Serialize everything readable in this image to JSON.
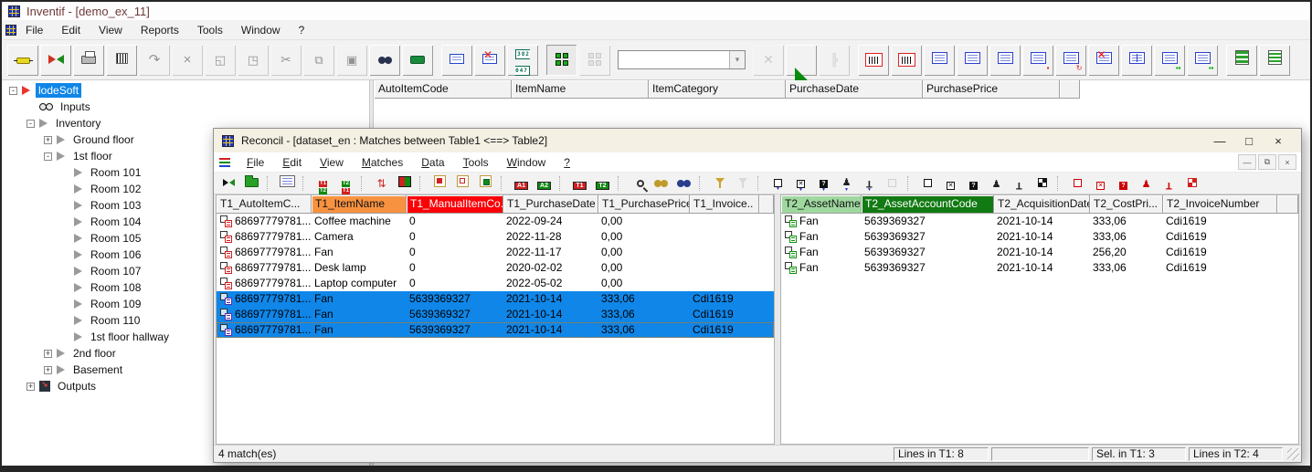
{
  "colors": {
    "selection_blue": "#0f86e8",
    "header_orange": "#f79240",
    "header_red": "#fb0107",
    "header_light_green": "#9fd89f",
    "header_dark_green": "#127a12",
    "title_text": "#6e3a38"
  },
  "main_window": {
    "title": "Inventif - [demo_ex_11]",
    "menu": [
      "File",
      "Edit",
      "View",
      "Reports",
      "Tools",
      "Window",
      "?"
    ],
    "toolbar_combo_value": "",
    "toolbar": [
      {
        "icon": "connector",
        "enabled": true
      },
      {
        "icon": "swap-arrows",
        "enabled": true
      },
      {
        "icon": "printer",
        "enabled": true
      },
      {
        "icon": "barcode-printer",
        "enabled": true
      },
      {
        "icon": "redo",
        "enabled": false
      },
      {
        "icon": "delete-line",
        "enabled": false
      },
      {
        "icon": "copy-item",
        "enabled": false
      },
      {
        "icon": "cut-item",
        "enabled": false
      },
      {
        "icon": "cut",
        "enabled": false
      },
      {
        "icon": "copy",
        "enabled": false
      },
      {
        "icon": "paste",
        "enabled": false
      },
      {
        "icon": "find-binoculars",
        "enabled": true
      },
      {
        "icon": "scanner",
        "enabled": true
      },
      {
        "type": "sep"
      },
      {
        "icon": "memo-card",
        "enabled": true
      },
      {
        "icon": "mail-delete",
        "enabled": true
      },
      {
        "icon": "counter-digits",
        "enabled": true
      },
      {
        "type": "sep"
      },
      {
        "icon": "group-objects",
        "enabled": true,
        "pressed": true
      },
      {
        "icon": "group-objects-alt",
        "enabled": false
      },
      {
        "type": "combo"
      },
      {
        "icon": "delete-cross",
        "enabled": false
      },
      {
        "icon": "set-square",
        "enabled": true
      },
      {
        "icon": "hierarchy",
        "enabled": false
      },
      {
        "type": "sep"
      },
      {
        "icon": "barcode-labels",
        "enabled": true
      },
      {
        "icon": "barcode-labels-alt",
        "enabled": true
      },
      {
        "icon": "doc-lines",
        "enabled": true
      },
      {
        "icon": "doc-list",
        "enabled": true
      },
      {
        "icon": "doc-list-detail",
        "enabled": true
      },
      {
        "icon": "doc-cube",
        "enabled": true
      },
      {
        "icon": "doc-refresh",
        "enabled": true
      },
      {
        "icon": "doc-delete",
        "enabled": true
      },
      {
        "icon": "doc-columns",
        "enabled": true
      },
      {
        "icon": "doc-cubes",
        "enabled": true
      },
      {
        "icon": "doc-cubes-alt",
        "enabled": true
      },
      {
        "type": "sep"
      },
      {
        "icon": "green-rows",
        "enabled": true
      },
      {
        "icon": "green-rows-alt",
        "enabled": true
      }
    ],
    "background_table": {
      "columns": [
        "AutoItemCode",
        "ItemName",
        "ItemCategory",
        "PurchaseDate",
        "PurchasePrice"
      ]
    },
    "tree": {
      "items": [
        {
          "label": "lodeSoft",
          "level": 0,
          "expander": "-",
          "icon": "red-arrow",
          "selected": true
        },
        {
          "label": "Inputs",
          "level": 1,
          "icon": "binoculars"
        },
        {
          "label": "Inventory",
          "level": 1,
          "expander": "-",
          "icon": "arrow"
        },
        {
          "label": "Ground floor",
          "level": 2,
          "expander": "+",
          "icon": "arrow"
        },
        {
          "label": "1st floor",
          "level": 2,
          "expander": "-",
          "icon": "arrow"
        },
        {
          "label": "Room 101",
          "level": 3,
          "icon": "arrow"
        },
        {
          "label": "Room 102",
          "level": 3,
          "icon": "arrow"
        },
        {
          "label": "Room 103",
          "level": 3,
          "icon": "arrow"
        },
        {
          "label": "Room 104",
          "level": 3,
          "icon": "arrow"
        },
        {
          "label": "Room 105",
          "level": 3,
          "icon": "arrow"
        },
        {
          "label": "Room 106",
          "level": 3,
          "icon": "arrow"
        },
        {
          "label": "Room 107",
          "level": 3,
          "icon": "arrow"
        },
        {
          "label": "Room 108",
          "level": 3,
          "icon": "arrow"
        },
        {
          "label": "Room 109",
          "level": 3,
          "icon": "arrow"
        },
        {
          "label": "Room 110",
          "level": 3,
          "icon": "arrow"
        },
        {
          "label": "1st floor hallway",
          "level": 3,
          "icon": "arrow"
        },
        {
          "label": "2nd floor",
          "level": 2,
          "expander": "+",
          "icon": "arrow"
        },
        {
          "label": "Basement",
          "level": 2,
          "expander": "+",
          "icon": "arrow"
        },
        {
          "label": "Outputs",
          "level": 1,
          "expander": "+",
          "icon": "outputs"
        }
      ]
    }
  },
  "reconcil_window": {
    "title": "Reconcil - [dataset_en : Matches between Table1 <==> Table2]",
    "window_buttons": [
      "minimize",
      "maximize",
      "close"
    ],
    "menu": [
      "File",
      "Edit",
      "View",
      "Matches",
      "Data",
      "Tools",
      "Window",
      "?"
    ],
    "mdi_buttons": [
      "minimize",
      "restore",
      "close"
    ],
    "toolbar": [
      {
        "icon": "match-arrows",
        "enabled": true
      },
      {
        "icon": "open-folder",
        "enabled": true
      },
      {
        "type": "sep"
      },
      {
        "icon": "properties-form",
        "enabled": true
      },
      {
        "type": "sep"
      },
      {
        "icon": "transfer-t1-t2",
        "enabled": true
      },
      {
        "icon": "transfer-t2-t1",
        "enabled": true
      },
      {
        "type": "sep"
      },
      {
        "icon": "sort-matches",
        "enabled": true
      },
      {
        "icon": "split-red-green",
        "enabled": true
      },
      {
        "type": "sep"
      },
      {
        "icon": "frame-filled",
        "enabled": true
      },
      {
        "icon": "frame-outline",
        "enabled": true
      },
      {
        "icon": "frame-green",
        "enabled": true
      },
      {
        "type": "sep"
      },
      {
        "icon": "badge-a1",
        "enabled": true
      },
      {
        "icon": "badge-a2",
        "enabled": true
      },
      {
        "type": "sep"
      },
      {
        "icon": "badge-t1",
        "enabled": true
      },
      {
        "icon": "badge-t2",
        "enabled": true
      },
      {
        "type": "sep"
      },
      {
        "icon": "zoom-search",
        "enabled": true
      },
      {
        "icon": "find-gold",
        "enabled": true
      },
      {
        "icon": "find-blue",
        "enabled": true
      },
      {
        "type": "sep"
      },
      {
        "icon": "filter",
        "enabled": true
      },
      {
        "icon": "filter-off",
        "enabled": false
      },
      {
        "type": "sep"
      },
      {
        "icon": "show-marked-box",
        "enabled": true
      },
      {
        "icon": "show-marked-cross",
        "enabled": true
      },
      {
        "icon": "show-marked-question",
        "enabled": true
      },
      {
        "icon": "show-marked-stamp-user",
        "enabled": true
      },
      {
        "icon": "show-marked-stamp",
        "enabled": true
      },
      {
        "icon": "show-marked-off",
        "enabled": false
      },
      {
        "type": "sep"
      },
      {
        "icon": "mark-box",
        "enabled": true
      },
      {
        "icon": "mark-cross",
        "enabled": true
      },
      {
        "icon": "mark-question",
        "enabled": true
      },
      {
        "icon": "mark-stamp-user",
        "enabled": true
      },
      {
        "icon": "mark-stamp",
        "enabled": true
      },
      {
        "icon": "mark-auto",
        "enabled": true
      },
      {
        "type": "sep"
      },
      {
        "icon": "unmark-box",
        "enabled": true
      },
      {
        "icon": "unmark-cross",
        "enabled": true
      },
      {
        "icon": "unmark-question",
        "enabled": true
      },
      {
        "icon": "unmark-stamp-user",
        "enabled": true
      },
      {
        "icon": "unmark-stamp",
        "enabled": true
      },
      {
        "icon": "unmark-auto",
        "enabled": true
      }
    ],
    "table1": {
      "columns": [
        {
          "label": "T1_AutoItemC...",
          "highlight": ""
        },
        {
          "label": "T1_ItemName",
          "highlight": "orange"
        },
        {
          "label": "T1_ManualItemCo...",
          "highlight": "red"
        },
        {
          "label": "T1_PurchaseDate",
          "highlight": ""
        },
        {
          "label": "T1_PurchasePrice",
          "highlight": ""
        },
        {
          "label": "T1_Invoice..",
          "highlight": ""
        }
      ],
      "rows": [
        {
          "icon": "unmatched",
          "cells": [
            "68697779781...",
            "Coffee machine",
            "0",
            "2022-09-24",
            "0,00",
            ""
          ]
        },
        {
          "icon": "unmatched",
          "cells": [
            "68697779781...",
            "Camera",
            "0",
            "2022-11-28",
            "0,00",
            ""
          ]
        },
        {
          "icon": "unmatched",
          "cells": [
            "68697779781...",
            "Fan",
            "0",
            "2022-11-17",
            "0,00",
            ""
          ]
        },
        {
          "icon": "unmatched",
          "cells": [
            "68697779781...",
            "Desk lamp",
            "0",
            "2020-02-02",
            "0,00",
            ""
          ]
        },
        {
          "icon": "unmatched",
          "cells": [
            "68697779781...",
            "Laptop computer",
            "0",
            "2022-05-02",
            "0,00",
            ""
          ]
        },
        {
          "icon": "matched",
          "selected": true,
          "cells": [
            "68697779781...",
            "Fan",
            "5639369327",
            "2021-10-14",
            "333,06",
            "Cdi1619"
          ]
        },
        {
          "icon": "matched",
          "selected": true,
          "cells": [
            "68697779781...",
            "Fan",
            "5639369327",
            "2021-10-14",
            "333,06",
            "Cdi1619"
          ]
        },
        {
          "icon": "matched",
          "selected": true,
          "focused": true,
          "cells": [
            "68697779781...",
            "Fan",
            "5639369327",
            "2021-10-14",
            "333,06",
            "Cdi1619"
          ]
        }
      ]
    },
    "table2": {
      "columns": [
        {
          "label": "T2_AssetName",
          "highlight": "lgreen"
        },
        {
          "label": "T2_AssetAccountCode",
          "highlight": "dgreen"
        },
        {
          "label": "T2_AcquisitionDate",
          "highlight": ""
        },
        {
          "label": "T2_CostPri...",
          "highlight": ""
        },
        {
          "label": "T2_InvoiceNumber",
          "highlight": ""
        }
      ],
      "rows": [
        {
          "icon": "matched",
          "cells": [
            "Fan",
            "5639369327",
            "2021-10-14",
            "333,06",
            "Cdi1619"
          ]
        },
        {
          "icon": "matched",
          "cells": [
            "Fan",
            "5639369327",
            "2021-10-14",
            "333,06",
            "Cdi1619"
          ]
        },
        {
          "icon": "matched",
          "cells": [
            "Fan",
            "5639369327",
            "2021-10-14",
            "256,20",
            "Cdi1619"
          ]
        },
        {
          "icon": "matched",
          "cells": [
            "Fan",
            "5639369327",
            "2021-10-14",
            "333,06",
            "Cdi1619"
          ]
        }
      ]
    },
    "status_bar": {
      "left": "4 match(es)",
      "panels": [
        "Lines in T1: 8",
        "",
        "Sel. in T1: 3",
        "Lines in T2: 4"
      ]
    }
  }
}
